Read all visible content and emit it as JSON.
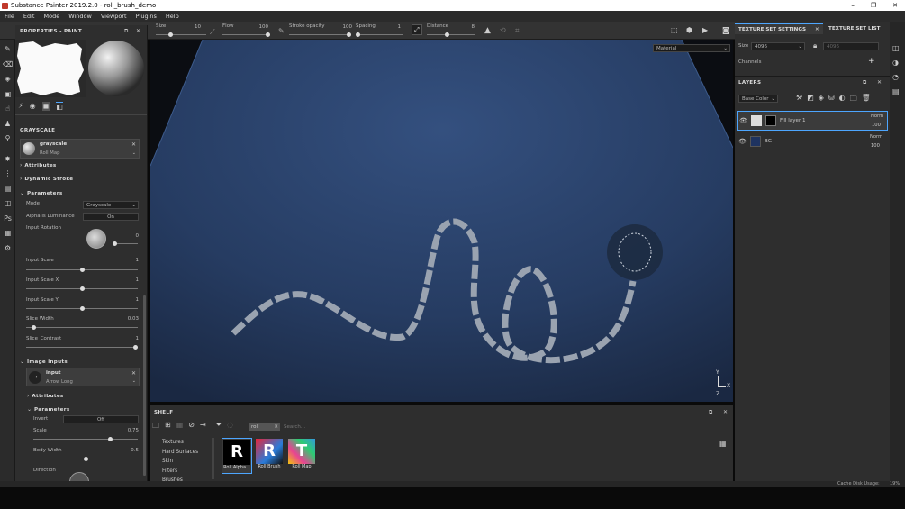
{
  "window": {
    "title": "Substance Painter 2019.2.0 - roll_brush_demo",
    "min": "–",
    "max": "❐",
    "close": "✕"
  },
  "menu": [
    "File",
    "Edit",
    "Mode",
    "Window",
    "Viewport",
    "Plugins",
    "Help"
  ],
  "toolbar": {
    "size_label": "Size",
    "size_value": "10",
    "flow_label": "Flow",
    "flow_value": "100",
    "opacity_label": "Stroke opacity",
    "opacity_value": "100",
    "spacing_label": "Spacing",
    "spacing_value": "1",
    "distance_label": "Distance",
    "distance_value": "8"
  },
  "props": {
    "title": "PROPERTIES - PAINT",
    "section": "GRAYSCALE",
    "resource_name": "grayscale",
    "resource_sub": "Roll Map",
    "attributes": "Attributes",
    "dynamic_stroke": "Dynamic Stroke",
    "parameters": "Parameters",
    "mode_label": "Mode",
    "mode_value": "Grayscale",
    "alpha_label": "Alpha is Luminance",
    "alpha_value": "On",
    "rotation_label": "Input Rotation",
    "rotation_value": "0",
    "scale_label": "Input Scale",
    "scale_value": "1",
    "scale_pct": 0.5,
    "scalex_label": "Input Scale X",
    "scalex_value": "1",
    "scalex_pct": 0.5,
    "scaley_label": "Input Scale Y",
    "scaley_value": "1",
    "scaley_pct": 0.5,
    "slice_label": "Slice Width",
    "slice_value": "0.03",
    "slice_pct": 0.05,
    "contrast_label": "Slice_Contrast",
    "contrast_value": "1",
    "contrast_pct": 1.0,
    "image_inputs": "Image inputs",
    "input_name": "input",
    "input_sub": "Arrow Long",
    "attributes2": "Attributes",
    "parameters2": "Parameters",
    "invert_label": "Invert",
    "invert_value": "Off",
    "scale2_label": "Scale",
    "scale2_value": "0.75",
    "scale2_pct": 0.75,
    "body_label": "Body Width",
    "body_value": "0.5",
    "body_pct": 0.5,
    "direction_label": "Direction"
  },
  "viewport": {
    "material": "Material"
  },
  "axes": {
    "y": "Y",
    "x": "X",
    "z": "Z"
  },
  "shelf": {
    "title": "SHELF",
    "filter_tag": "roll",
    "search_placeholder": "Search...",
    "categories": [
      "Textures",
      "Hard Surfaces",
      "Skin",
      "Filters",
      "Brushes"
    ],
    "items": [
      {
        "label": "Roll Alpha..."
      },
      {
        "label": "Roll Brush"
      },
      {
        "label": "Roll Map"
      }
    ]
  },
  "texset": {
    "tab1": "TEXTURE SET SETTINGS",
    "tab2": "TEXTURE SET LIST",
    "size_label": "Size",
    "size_value": "4096",
    "size_value2": "4096",
    "channels": "Channels"
  },
  "layers": {
    "title": "LAYERS",
    "channel": "Base Color",
    "items": [
      {
        "name": "Fill layer 1",
        "blend": "Norm",
        "opacity": "100"
      },
      {
        "name": "BG",
        "blend": "Norm",
        "opacity": "100"
      }
    ]
  },
  "status": {
    "cache": "Cache Disk Usage:",
    "cache_value": "19%"
  }
}
